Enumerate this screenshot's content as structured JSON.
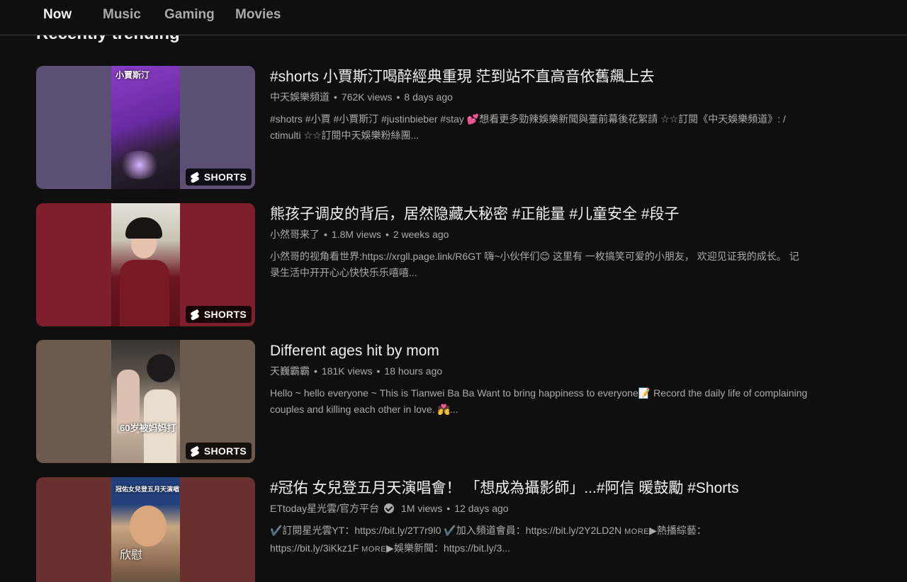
{
  "tabs": [
    {
      "label": "Now",
      "active": true
    },
    {
      "label": "Music",
      "active": false
    },
    {
      "label": "Gaming",
      "active": false
    },
    {
      "label": "Movies",
      "active": false
    }
  ],
  "section": {
    "title": "Recently trending"
  },
  "badge_label": "SHORTS",
  "videos": [
    {
      "title": "#shorts 小賈斯汀喝醉經典重現 茫到站不直高音依舊飆上去",
      "channel": "中天娛樂頻道",
      "views": "762K views",
      "age": "8 days ago",
      "description": "#shotrs #小賈 #小賈斯汀 #justinbieber #stay 💕想看更多勁辣娛樂新聞與臺前幕後花絮請 ☆☆訂閱《中天娛樂頻道》: / ctimulti ☆☆訂閱中天娛樂粉絲團...",
      "thumb_caption": "小賈斯汀"
    },
    {
      "title": "熊孩子调皮的背后，居然隐藏大秘密 #正能量 #儿童安全 #段子",
      "channel": "小然哥来了",
      "views": "1.8M views",
      "age": "2 weeks ago",
      "description": "小然哥的视角看世界:https://xrgll.page.link/R6GT 嗨~小伙伴们😊 这里有 一枚搞笑可爱的小朋友， 欢迎见证我的成长。 记录生活中开开心心快快乐乐嘻嘻...",
      "thumb_caption": ""
    },
    {
      "title": "Different ages hit by mom",
      "channel": "天巍霸霸",
      "views": "181K views",
      "age": "18 hours ago",
      "description": "Hello ~ hello everyone ~ This is Tianwei Ba Ba Want to bring happiness to everyone📝 Record the daily life of complaining couples and killing each other in love. 💏...",
      "thumb_caption": "60岁被妈妈打"
    },
    {
      "title": "#冠佑 女兒登五月天演唱會！ 「想成為攝影師」...#阿信 暖鼓勵 #Shorts",
      "channel": "ETtoday星光雲/官方平台",
      "views": "1M views",
      "age": "12 days ago",
      "desc_line1_a": "✔️訂閱星光雲YT：https://bit.ly/2T7r9l0 ✔️加入頻道會員：https://bit.ly/2Y2LD2N ",
      "desc_more": "MORE",
      "desc_line1_b": "▶熱播綜藝：",
      "desc_line2_a": "https://bit.ly/3iKkz1F ",
      "desc_line2_b": "▶娛樂新聞：https://bit.ly/3...",
      "thumb_caption": "欣慰",
      "thumb_banner": "冠佑女兒登五月天演唱會!"
    }
  ],
  "colors": {
    "background": "#0f0f0f",
    "text_primary": "#f1f1f1",
    "text_secondary": "#aaaaaa"
  }
}
